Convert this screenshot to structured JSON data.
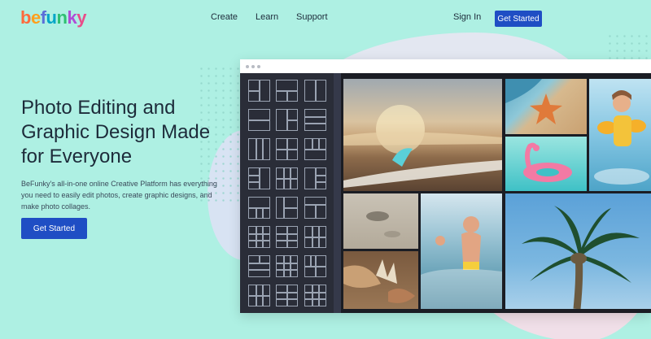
{
  "brand": {
    "logo_text": "befunky"
  },
  "nav": {
    "links": [
      "Create",
      "Learn",
      "Support"
    ],
    "sign_in": "Sign In",
    "cta": "Get Started"
  },
  "hero": {
    "title": "Photo Editing and Graphic Design Made for Everyone",
    "description": "BeFunky's all-in-one online Creative Platform has everything you need to easily edit photos, create graphic designs, and make photo collages.",
    "cta": "Get Started"
  },
  "app_window": {
    "panels": [
      "collage-layout-templates",
      "photo-collage-canvas"
    ]
  },
  "colors": {
    "background": "#aef0e3",
    "primary_button": "#1f4ec4",
    "window_dark": "#2a2d38"
  }
}
